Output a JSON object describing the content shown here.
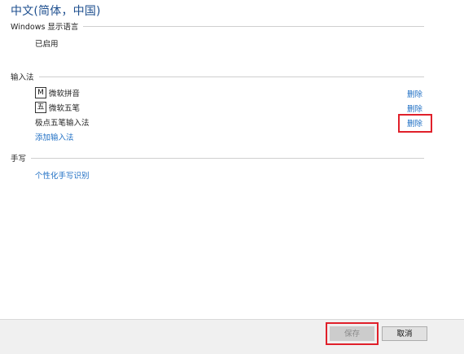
{
  "page": {
    "title": "中文(简体，中国)"
  },
  "display_language": {
    "header": "Windows 显示语言",
    "status": "已启用"
  },
  "input_methods": {
    "header": "输入法",
    "items": [
      {
        "icon_name": "ime-m-icon",
        "icon_glyph": "M",
        "label": "微软拼音",
        "delete_label": "删除"
      },
      {
        "icon_name": "ime-wu-icon",
        "icon_glyph": "五",
        "label": "微软五笔",
        "delete_label": "删除"
      },
      {
        "icon_name": "",
        "icon_glyph": "",
        "label": "极点五笔输入法",
        "delete_label": "删除"
      }
    ],
    "add_label": "添加输入法"
  },
  "handwriting": {
    "header": "手写",
    "personalize_label": "个性化手写识别"
  },
  "footer": {
    "save_label": "保存",
    "cancel_label": "取消"
  },
  "colors": {
    "title": "#1e4f8f",
    "link": "#1f6fc4",
    "highlight": "#e0202a"
  }
}
